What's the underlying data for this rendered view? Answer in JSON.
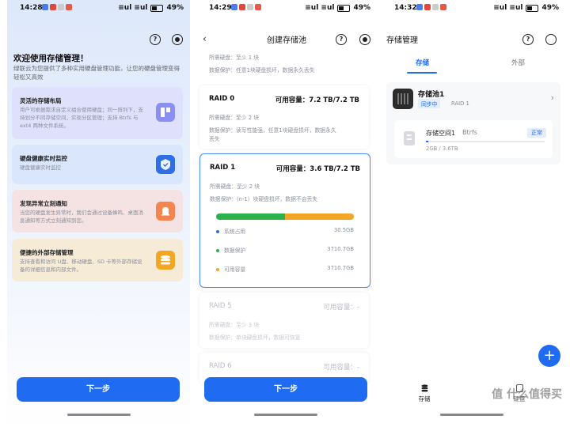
{
  "statusbar": {
    "p1_time": "14:28",
    "p2_time": "14:29",
    "p3_time": "14:32",
    "battery": "49%",
    "signal": "≡ul ≡ul"
  },
  "screen1": {
    "title": "欢迎使用存储管理！",
    "description": "绿联云为您提供了多种实用硬盘管理功能，让您的硬盘管理变得轻松又高效",
    "features": [
      {
        "title": "灵活的存储布局",
        "desc": "用户可根据需求自定义组合使用硬盘；同一阵列下，支持划分不同存储空间，实现分区管理；支持 Btrfs 与 ext4 两种文件系统。",
        "icon": "layout-icon",
        "bg": "#dfe0fb",
        "icon_color": "#7b7ef0"
      },
      {
        "title": "硬盘健康实时监控",
        "desc": "硬盘健康实时监控",
        "icon": "shield-icon",
        "bg": "#d9e6fb",
        "icon_color": "#2f6fe6"
      },
      {
        "title": "发现异常立刻通知",
        "desc": "当您的硬盘发生异常时，我们会通过设备蜂鸣、桌面消息通知等方式立刻通知到您。",
        "icon": "bell-icon",
        "bg": "#f5e3e3",
        "icon_color": "#f0773f"
      },
      {
        "title": "便捷的外部存储管理",
        "desc": "支持查看和访问 U盘、移动硬盘、SD 卡等外部存储设备的详细信息和内部文件。",
        "icon": "stack-icon",
        "bg": "#f5ebd6",
        "icon_color": "#f2a624"
      }
    ],
    "next_label": "下一步"
  },
  "screen2": {
    "header": "创建存储池",
    "top_lines": [
      "所需硬盘：至少 1 块",
      "数据保护：任意1块硬盘损坏，数据永久丢失"
    ],
    "raid0": {
      "name": "RAID 0",
      "capacity": "可用容量：7.2 TB/7.2 TB",
      "disks": "所需硬盘：至少 2 块",
      "protect1": "数据保护：读写性能强，任意1块硬盘损坏，数据永久",
      "protect2": "丢失"
    },
    "raid1": {
      "name": "RAID 1",
      "capacity": "可用容量：3.6 TB/7.2 TB",
      "disks": "所需硬盘：至少 2 块",
      "protect": "数据保护：(n-1）块硬盘损坏，数据不会丢失",
      "usage": [
        {
          "label": "系统占用",
          "value": "30.5GB",
          "color": "#2f6fe6",
          "fraction": 0.0
        },
        {
          "label": "数据保护",
          "value": "3710.7GB",
          "color": "#2bb24c",
          "fraction": 0.5
        },
        {
          "label": "可用容量",
          "value": "3710.7GB",
          "color": "#f2a624",
          "fraction": 0.5
        }
      ]
    },
    "raid5": {
      "name": "RAID 5",
      "capacity": "可用容量：-",
      "disks": "所需硬盘：至少 3 块",
      "protect": "数据保护：单块硬盘损坏，数据可恢复"
    },
    "raid6": {
      "name": "RAID 6",
      "capacity": "可用容量：-"
    },
    "next_label": "下一步"
  },
  "screen3": {
    "title": "存储管理",
    "tabs": [
      "存储",
      "外部"
    ],
    "pool": {
      "name": "存储池1",
      "status": "同步中",
      "raid": "RAID 1"
    },
    "space": {
      "name": "存储空间1",
      "fs": "Btrfs",
      "badge": "正常",
      "usage": "2GB / 3.6TB",
      "fraction": 0.0006
    },
    "fab": "+",
    "nav": [
      "存储",
      "硬盘"
    ]
  },
  "watermark": "值 什么值得买"
}
